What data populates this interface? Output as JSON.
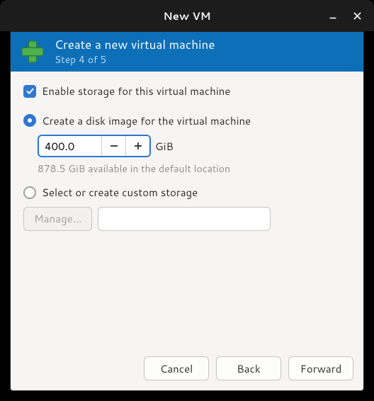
{
  "window": {
    "title": "New VM"
  },
  "header": {
    "title": "Create a new virtual machine",
    "step": "Step 4 of 5"
  },
  "storage": {
    "enable_label": "Enable storage for this virtual machine",
    "create_image_label": "Create a disk image for the virtual machine",
    "size_value": "400.0",
    "size_unit": "GiB",
    "available_hint": "878.5 GiB available in the default location",
    "custom_label": "Select or create custom storage",
    "manage_label": "Manage...",
    "path_value": ""
  },
  "buttons": {
    "cancel": "Cancel",
    "back": "Back",
    "forward": "Forward"
  }
}
